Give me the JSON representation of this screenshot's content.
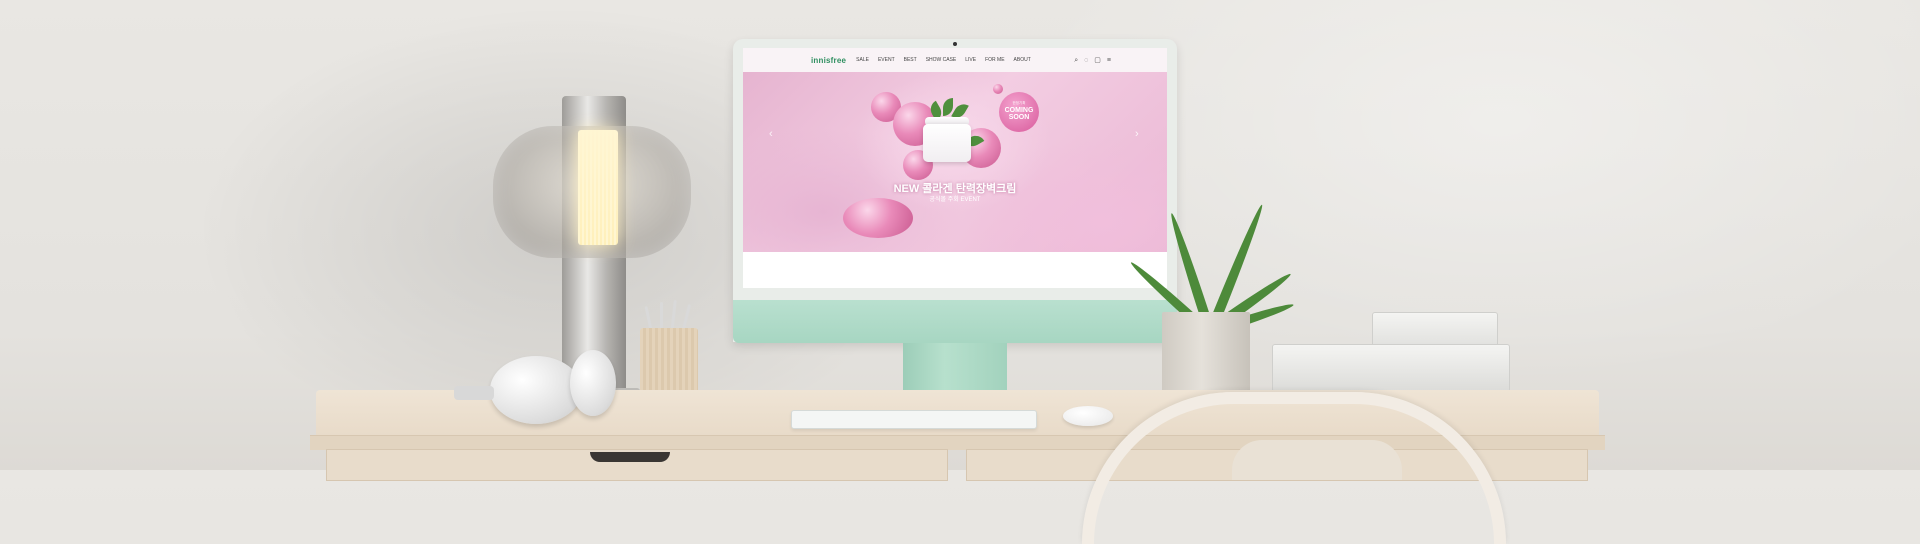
{
  "scene": "desk-mockup",
  "site": {
    "logo": "innisfree",
    "nav_items": [
      "SALE",
      "EVENT",
      "BEST",
      "SHOW CASE",
      "LIVE",
      "FOR ME",
      "ABOUT"
    ],
    "nav_icons": [
      "search-icon",
      "user-icon",
      "bag-icon",
      "menu-icon"
    ]
  },
  "hero": {
    "badge_small": "한정기획",
    "badge_line1": "COMING",
    "badge_line2": "SOON",
    "title": "NEW 콜라겐 탄력장벽크림",
    "subtitle": "공식몰 주회 EVENT",
    "prev_arrow": "‹",
    "next_arrow": "›"
  },
  "colors": {
    "logo_green": "#2f8f60",
    "monitor_green": "#a7d6c2",
    "hero_pink": "#eab7d4"
  }
}
